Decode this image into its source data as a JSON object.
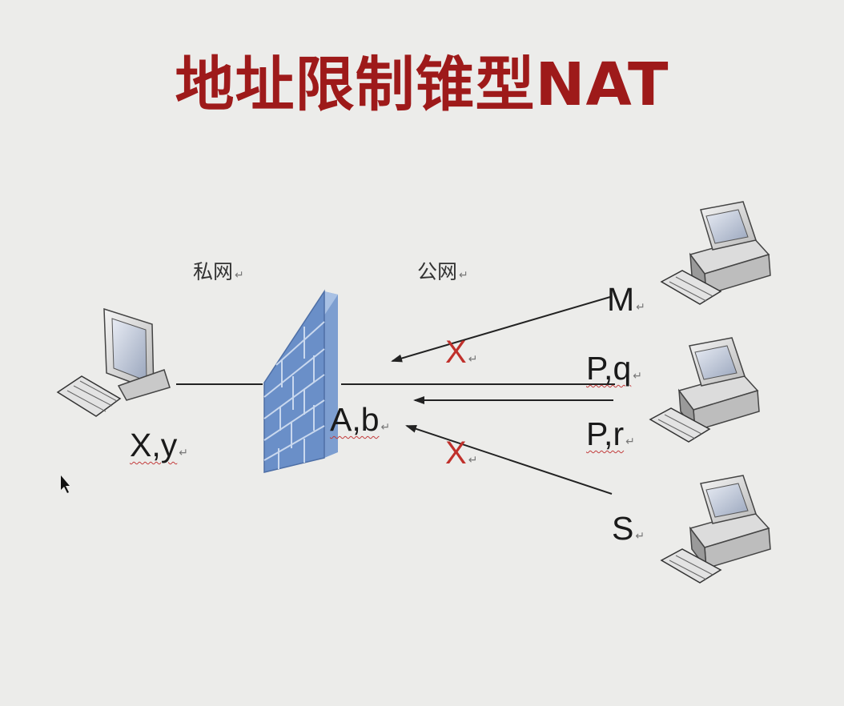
{
  "title": "地址限制锥型NAT",
  "zones": {
    "private": "私网",
    "public": "公网"
  },
  "labels": {
    "client": "X,y",
    "nat": "A,b",
    "host_m": "M",
    "host_pq": "P,q",
    "host_pr": "P,r",
    "host_s": "S"
  },
  "return_symbol": "↵",
  "blocked_mark": "X"
}
